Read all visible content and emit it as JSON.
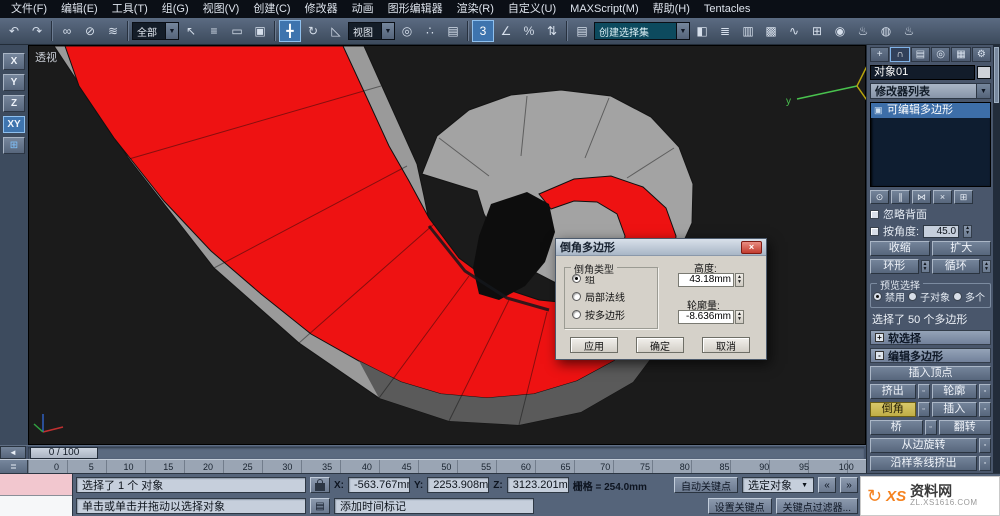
{
  "menubar": {
    "items": [
      "文件(F)",
      "编辑(E)",
      "工具(T)",
      "组(G)",
      "视图(V)",
      "创建(C)",
      "修改器",
      "动画",
      "图形编辑器",
      "渲染(R)",
      "自定义(U)",
      "MAXScript(M)",
      "帮助(H)",
      "Tentacles"
    ]
  },
  "toolbar": {
    "filter_value": "全部",
    "coord_value": "视图",
    "named_sel_value": "创建选择集",
    "dd_arrow": "▼",
    "ic_undo": "↶",
    "ic_redo": "↷",
    "ic_link": "∞",
    "ic_unlink": "⊘",
    "ic_bind": "≋",
    "ic_select": "↖",
    "ic_byname": "≡",
    "ic_region": "▭",
    "ic_window": "▣",
    "ic_move": "╋",
    "ic_rotate": "↻",
    "ic_scale": "◺",
    "ic_pivot": "◎",
    "ic_manip": "∴",
    "ic_kbd": "▤",
    "ic_snap": "3",
    "ic_asnap": "∠",
    "ic_psnap": "%",
    "ic_ssnap": "⇅",
    "ic_namedsel": "▤",
    "ic_mirror": "◧",
    "ic_align": "≣",
    "ic_layers": "▥",
    "ic_ribbon": "▩",
    "ic_curve": "∿",
    "ic_schem": "⊞",
    "ic_mtl": "◉",
    "ic_rsetup": "♨",
    "ic_rframe": "◍",
    "ic_render": "♨"
  },
  "axis_toolbar": {
    "x": "X",
    "y": "Y",
    "z": "Z",
    "xy": "XY",
    "snap_glyph": "⊞"
  },
  "viewport": {
    "label": "透视",
    "axis_y_label": "y",
    "selection_color": "#ee1212"
  },
  "dialog": {
    "title": "倒角多边形",
    "close_glyph": "×",
    "group_title": "倒角类型",
    "radio_group": "组",
    "radio_local": "局部法线",
    "radio_poly": "按多边形",
    "height_label": "高度:",
    "height_value": "43.18mm",
    "outline_label": "轮廓量:",
    "outline_value": "-8.636mm",
    "apply": "应用",
    "ok": "确定",
    "cancel": "取消"
  },
  "panel": {
    "tab_create": "+",
    "tab_modify": "∩",
    "tab_hierarchy": "▤",
    "tab_motion": "◎",
    "tab_display": "▦",
    "tab_util": "⚙",
    "object_name": "对象01",
    "modifier_list": "修改器列表",
    "stack_item": "可编辑多边形",
    "st_pin": "⊙",
    "st_end": "∥",
    "st_unique": "⋈",
    "st_remove": "×",
    "st_config": "⊞",
    "ignore_backfacing": "忽略背面",
    "by_angle": "按角度:",
    "by_angle_value": "45.0",
    "shrink": "收缩",
    "grow": "扩大",
    "ring": "环形",
    "loop": "循环",
    "preview_title": "预览选择",
    "preview_disable": "禁用",
    "preview_subobj": "子对象",
    "preview_multi": "多个",
    "status": "选择了 50 个多边形",
    "soft_selection": "软选择",
    "edit_polygons": "编辑多边形",
    "insert_vertex": "插入顶点",
    "extrude": "挤出",
    "outline": "轮廓",
    "bevel": "倒角",
    "inset": "插入",
    "bridge": "桥",
    "flip": "翻转",
    "hinge": "从边旋转",
    "spline_extrude": "沿样条线挤出",
    "plus": "+",
    "minus": "-",
    "settings_glyph": "▫"
  },
  "timeline": {
    "slider": "0 / 100",
    "mini_glyph": "◄",
    "lead_glyph": "≣",
    "ticks": [
      "0",
      "5",
      "10",
      "15",
      "20",
      "25",
      "30",
      "35",
      "40",
      "45",
      "50",
      "55",
      "60",
      "65",
      "70",
      "75",
      "80",
      "85",
      "90",
      "95",
      "100"
    ]
  },
  "status": {
    "selection": "选择了 1 个 对象",
    "prompt": "单击或单击并拖动以选择对象",
    "x_label": "X:",
    "x_value": "-563.767mm",
    "y_label": "Y:",
    "y_value": "2253.908mm",
    "z_label": "Z:",
    "z_value": "3123.201mm",
    "grid": "栅格 = 254.0mm",
    "auto_key": "自动关键点",
    "sel_mode": "选定对象",
    "set_key": "设置关键点",
    "key_filters": "关键点过滤器...",
    "time_tag": "添加时间标记",
    "prev_glyph": "«",
    "next_glyph": "»",
    "kbd_glyph": "▤"
  },
  "watermark": {
    "swirl": "↻",
    "logo": "XS",
    "name": "资料网",
    "url": "ZL.XS1616.COM"
  }
}
